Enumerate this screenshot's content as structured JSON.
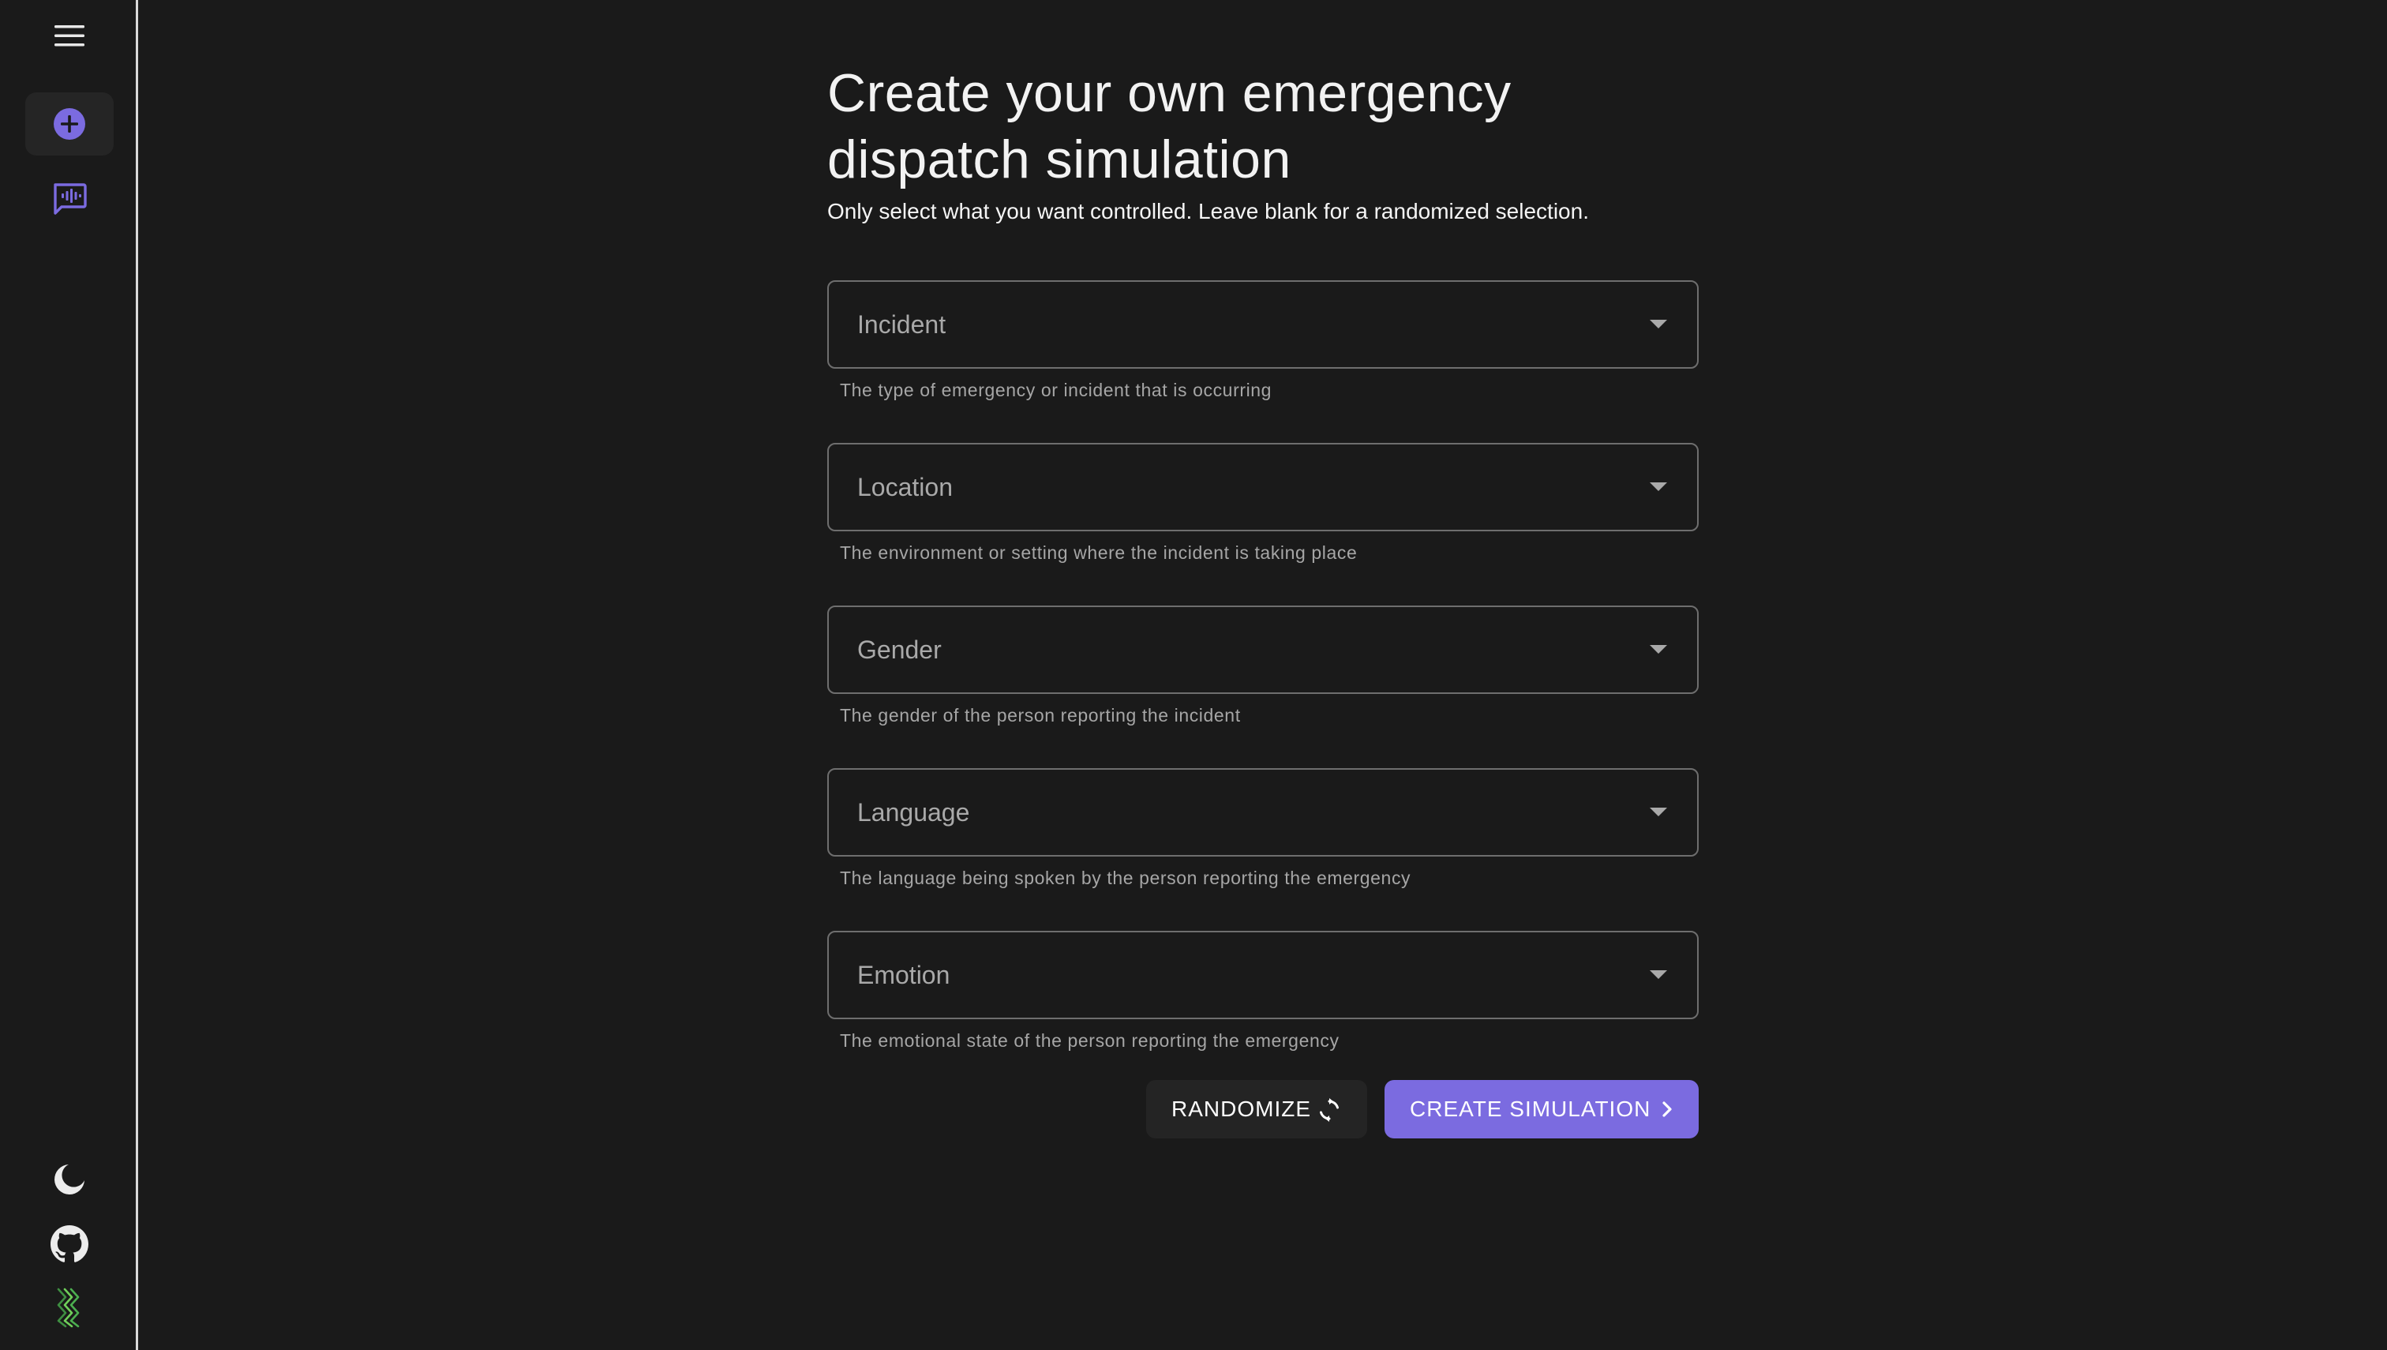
{
  "sidebar": {
    "items": [
      {
        "name": "menu",
        "icon": "menu-icon"
      },
      {
        "name": "new-simulation",
        "icon": "add-circle-icon",
        "active": true
      },
      {
        "name": "transcripts",
        "icon": "voice-chat-icon"
      }
    ],
    "footer": [
      {
        "name": "theme-toggle",
        "icon": "moon-icon"
      },
      {
        "name": "github",
        "icon": "github-icon"
      },
      {
        "name": "logo",
        "icon": "app-logo-icon"
      }
    ]
  },
  "page": {
    "title_line1": "Create your own emergency",
    "title_line2": "dispatch simulation",
    "subtitle": "Only select what you want controlled. Leave blank for a randomized selection."
  },
  "fields": [
    {
      "label": "Incident",
      "helper": "The type of emergency or incident that is occurring",
      "value": ""
    },
    {
      "label": "Location",
      "helper": "The environment or setting where the incident is taking place",
      "value": ""
    },
    {
      "label": "Gender",
      "helper": "The gender of the person reporting the incident",
      "value": ""
    },
    {
      "label": "Language",
      "helper": "The language being spoken by the person reporting the emergency",
      "value": ""
    },
    {
      "label": "Emotion",
      "helper": "The emotional state of the person reporting the emergency",
      "value": ""
    }
  ],
  "actions": {
    "randomize_label": "RANDOMIZE",
    "randomize_icon": "refresh-icon",
    "create_label": "CREATE SIMULATION",
    "create_icon": "chevron-right-icon"
  },
  "colors": {
    "background": "#1a1a1a",
    "accent": "#7b6be0",
    "sidebar_icon": "#7b6be0",
    "logo_green": "#4caf50"
  }
}
